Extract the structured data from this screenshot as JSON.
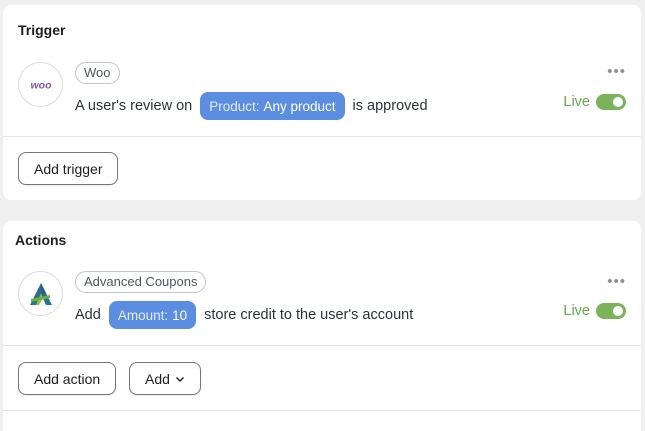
{
  "trigger": {
    "title": "Trigger",
    "app_icon": "woo-icon",
    "app_logo_text": "woo",
    "app_name": "Woo",
    "sentence_before": "A user's review on",
    "token_key": "Product:",
    "token_value": "Any product",
    "sentence_after": "is approved",
    "status_label": "Live",
    "status_on": true,
    "add_button": "Add trigger"
  },
  "actions": {
    "title": "Actions",
    "app_icon": "advanced-coupons-icon",
    "app_name": "Advanced Coupons",
    "sentence_before": "Add",
    "token_key": "Amount:",
    "token_value": "10",
    "sentence_after": "store credit to the user's account",
    "status_label": "Live",
    "status_on": true,
    "add_action_button": "Add action",
    "add_dropdown_button": "Add"
  },
  "colors": {
    "token_bg": "#5b8de1",
    "live_green": "#6aa84f",
    "toggle_green": "#7cb35a",
    "woo_purple": "#7f54b3"
  }
}
